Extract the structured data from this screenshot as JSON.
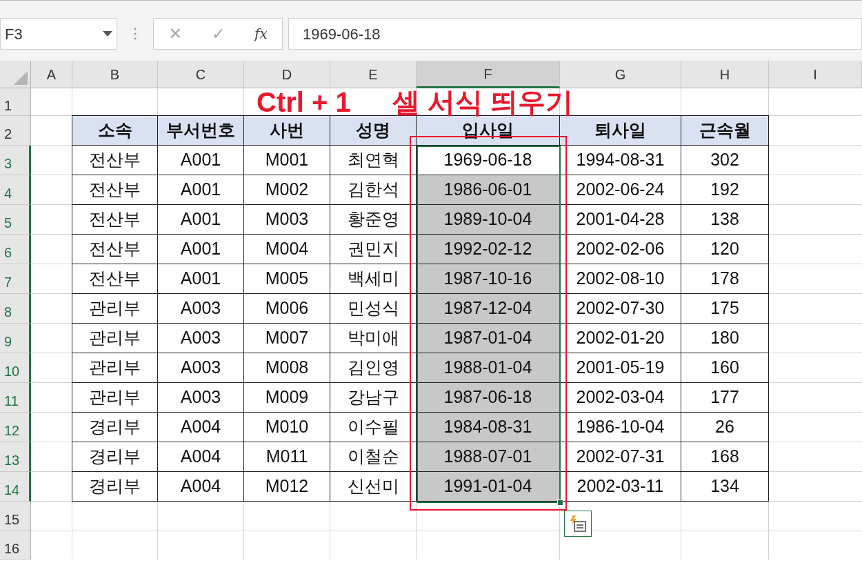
{
  "formula_bar": {
    "name_box": "F3",
    "cancel": "✕",
    "enter": "✓",
    "function": "fx",
    "value": "1969-06-18"
  },
  "caption": [
    "Ctrl + 1",
    "셀 서식 띄우기"
  ],
  "column_headers": [
    {
      "label": "A",
      "selected": false
    },
    {
      "label": "B",
      "selected": false
    },
    {
      "label": "C",
      "selected": false
    },
    {
      "label": "D",
      "selected": false
    },
    {
      "label": "E",
      "selected": false
    },
    {
      "label": "F",
      "selected": true
    },
    {
      "label": "G",
      "selected": false
    },
    {
      "label": "H",
      "selected": false
    },
    {
      "label": "I",
      "selected": false
    }
  ],
  "row_headers": [
    {
      "label": "1",
      "selected": false
    },
    {
      "label": "2",
      "selected": false
    },
    {
      "label": "3",
      "selected": true
    },
    {
      "label": "4",
      "selected": true
    },
    {
      "label": "5",
      "selected": true
    },
    {
      "label": "6",
      "selected": true
    },
    {
      "label": "7",
      "selected": true
    },
    {
      "label": "8",
      "selected": true
    },
    {
      "label": "9",
      "selected": true
    },
    {
      "label": "10",
      "selected": true
    },
    {
      "label": "11",
      "selected": true
    },
    {
      "label": "12",
      "selected": true
    },
    {
      "label": "13",
      "selected": true
    },
    {
      "label": "14",
      "selected": true
    },
    {
      "label": "15",
      "selected": false
    },
    {
      "label": "16",
      "selected": false
    }
  ],
  "table": {
    "columns": [
      "소속",
      "부서번호",
      "사번",
      "성명",
      "입사일",
      "퇴사일",
      "근속월"
    ],
    "rows": [
      {
        "active": true,
        "cells": [
          "전산부",
          "A001",
          "M001",
          "최연혁",
          "1969-06-18",
          "1994-08-31",
          "302"
        ]
      },
      {
        "active": false,
        "cells": [
          "전산부",
          "A001",
          "M002",
          "김한석",
          "1986-06-01",
          "2002-06-24",
          "192"
        ]
      },
      {
        "active": false,
        "cells": [
          "전산부",
          "A001",
          "M003",
          "황준영",
          "1989-10-04",
          "2001-04-28",
          "138"
        ]
      },
      {
        "active": false,
        "cells": [
          "전산부",
          "A001",
          "M004",
          "권민지",
          "1992-02-12",
          "2002-02-06",
          "120"
        ]
      },
      {
        "active": false,
        "cells": [
          "전산부",
          "A001",
          "M005",
          "백세미",
          "1987-10-16",
          "2002-08-10",
          "178"
        ]
      },
      {
        "active": false,
        "cells": [
          "관리부",
          "A003",
          "M006",
          "민성식",
          "1987-12-04",
          "2002-07-30",
          "175"
        ]
      },
      {
        "active": false,
        "cells": [
          "관리부",
          "A003",
          "M007",
          "박미애",
          "1987-01-04",
          "2002-01-20",
          "180"
        ]
      },
      {
        "active": false,
        "cells": [
          "관리부",
          "A003",
          "M008",
          "김인영",
          "1988-01-04",
          "2001-05-19",
          "160"
        ]
      },
      {
        "active": false,
        "cells": [
          "관리부",
          "A003",
          "M009",
          "강남구",
          "1987-06-18",
          "2002-03-04",
          "177"
        ]
      },
      {
        "active": false,
        "cells": [
          "경리부",
          "A004",
          "M010",
          "이수필",
          "1984-08-31",
          "1986-10-04",
          "26"
        ]
      },
      {
        "active": false,
        "cells": [
          "경리부",
          "A004",
          "M011",
          "이철순",
          "1988-07-01",
          "2002-07-31",
          "168"
        ]
      },
      {
        "active": false,
        "cells": [
          "경리부",
          "A004",
          "M012",
          "신선미",
          "1991-01-04",
          "2002-03-11",
          "134"
        ]
      }
    ]
  }
}
